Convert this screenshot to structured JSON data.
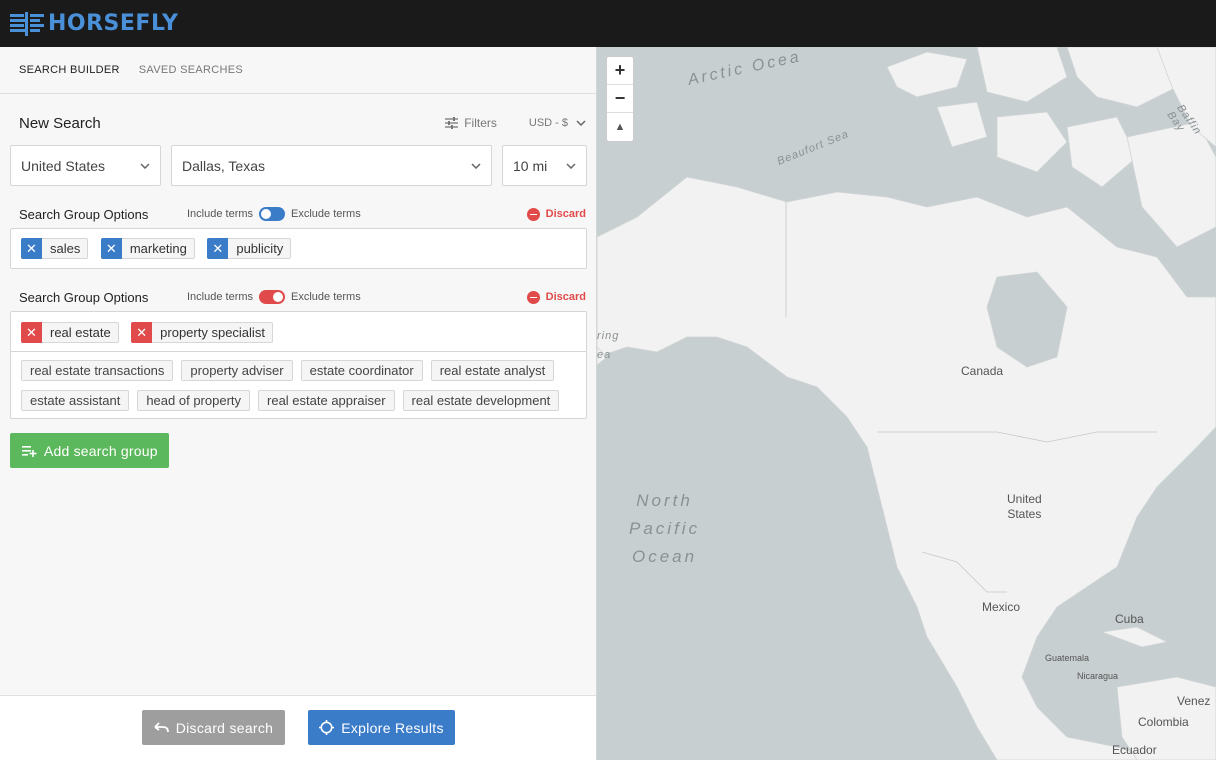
{
  "app": {
    "name": "HORSEFLY",
    "brand_color": "#4a90d9"
  },
  "tabs": [
    {
      "label": "SEARCH BUILDER",
      "active": true
    },
    {
      "label": "SAVED SEARCHES",
      "active": false
    }
  ],
  "search": {
    "title": "New Search",
    "filters_label": "Filters",
    "currency": "USD - $",
    "country": "United States",
    "location": "Dallas, Texas",
    "radius": "10 mi"
  },
  "groups": [
    {
      "title": "Search Group Options",
      "include_label": "Include terms",
      "exclude_label": "Exclude terms",
      "mode": "include",
      "discard_label": "Discard",
      "terms": [
        "sales",
        "marketing",
        "publicity"
      ],
      "suggestions": []
    },
    {
      "title": "Search Group Options",
      "include_label": "Include terms",
      "exclude_label": "Exclude terms",
      "mode": "exclude",
      "discard_label": "Discard",
      "terms": [
        "real estate",
        "property specialist"
      ],
      "suggestions": [
        "real estate transactions",
        "property adviser",
        "estate coordinator",
        "real estate analyst",
        "estate assistant",
        "head of property",
        "real estate appraiser",
        "real estate development"
      ]
    }
  ],
  "add_group_label": "Add search group",
  "footer": {
    "discard_label": "Discard search",
    "explore_label": "Explore Results"
  },
  "colors": {
    "include": "#3b7cc9",
    "exclude": "#e04a4a",
    "add": "#5cb85c",
    "discard_btn": "#9e9e9e",
    "explore_btn": "#3b7cc9"
  },
  "map": {
    "zoom_in": "+",
    "zoom_out": "−",
    "compass": "▲",
    "labels": {
      "arctic": "Arctic Ocea",
      "beaufort": "Beaufort Sea",
      "baffin": "Baffin Bay",
      "bering_1": "ring",
      "bering_2": "ea",
      "canada": "Canada",
      "us_1": "United",
      "us_2": "States",
      "pacific_1": "North",
      "pacific_2": "Pacific",
      "pacific_3": "Ocean",
      "mexico": "Mexico",
      "cuba": "Cuba",
      "guatemala": "Guatemala",
      "nicaragua": "Nicaragua",
      "venezuela": "Venez",
      "colombia": "Colombia",
      "ecuador": "Ecuador"
    }
  }
}
